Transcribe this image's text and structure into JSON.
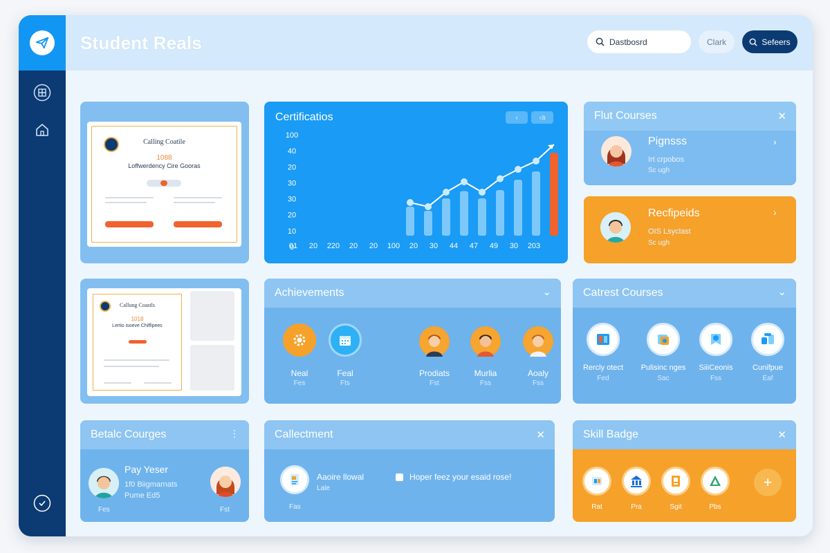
{
  "app": {
    "title": "Student Reals",
    "search_text": "Dastbosrd",
    "clear_label": "Clark",
    "primary_button_label": "Sefeers"
  },
  "certificate_preview": {
    "title": "Calling Coatile",
    "number": "1088",
    "subtitle": "Loffwerdency Cire Gooras"
  },
  "certificate_preview_2": {
    "title": "Callung Coastls",
    "number": "1018",
    "subtitle": "Lertio isoeve Chiffipees"
  },
  "certifications_chart": {
    "title": "Certificatios",
    "button_1": "‹",
    "button_2": "‹a"
  },
  "chart_data": {
    "type": "bar",
    "title": "Certificatios",
    "y_ticks": [
      "100",
      "40",
      "20",
      "30",
      "30",
      "20",
      "10",
      "0"
    ],
    "x_ticks": [
      "01",
      "20",
      "220",
      "20",
      "20",
      "100",
      "20",
      "30",
      "44",
      "47",
      "49",
      "30",
      "203"
    ],
    "values": [
      28,
      24,
      36,
      43,
      36,
      44,
      54,
      62,
      80
    ],
    "line_values": [
      32,
      28,
      42,
      52,
      42,
      55,
      64,
      72,
      88
    ],
    "highlight_last": true,
    "colors": {
      "bars": "#8fd0fb",
      "highlight": "#f0622e",
      "line": "#ffffff"
    }
  },
  "full_courses": {
    "title": "Flut Courses",
    "items": [
      {
        "title": "Pignsss",
        "line1": "Irt crpobos",
        "line2": "Sc ugh"
      },
      {
        "title": "Recfipeids",
        "line1": "OIS Lsyclast",
        "line2": "Sc ugh"
      }
    ]
  },
  "achievements": {
    "title": "Achievements",
    "items": [
      {
        "label": "Neal",
        "sub": "Fes"
      },
      {
        "label": "Feal",
        "sub": "Fts"
      },
      {
        "label": "Prodiats",
        "sub": "Fst"
      },
      {
        "label": "Murlia",
        "sub": "Fss"
      },
      {
        "label": "Aoaly",
        "sub": "Fss"
      }
    ]
  },
  "latest_courses": {
    "title": "Catrest Courses",
    "items": [
      {
        "label": "Rercly otect",
        "sub": "Fed"
      },
      {
        "label": "Pulisinc nges",
        "sub": "Sac"
      },
      {
        "label": "SiiiCeonis",
        "sub": "Fss"
      },
      {
        "label": "Cunifpue",
        "sub": "Eaf"
      }
    ]
  },
  "betalc_courses": {
    "title": "Betalc Courges",
    "name": "Pay Yeser",
    "line1": "1f0 Biigmarnats",
    "line2": "Pume Ed5",
    "left_sub": "Fes",
    "right_sub": "Fst"
  },
  "callectment": {
    "title": "Callectment",
    "item_title": "Aaoire llowal",
    "item_sub": "Lale",
    "item_foot": "Fas",
    "note": "Hoper feez your esaid rose!"
  },
  "skill_badge": {
    "title": "Skill Badge",
    "items": [
      {
        "label": "Rat"
      },
      {
        "label": "Pra"
      },
      {
        "label": "Sgit"
      },
      {
        "label": "Pbs"
      }
    ]
  }
}
